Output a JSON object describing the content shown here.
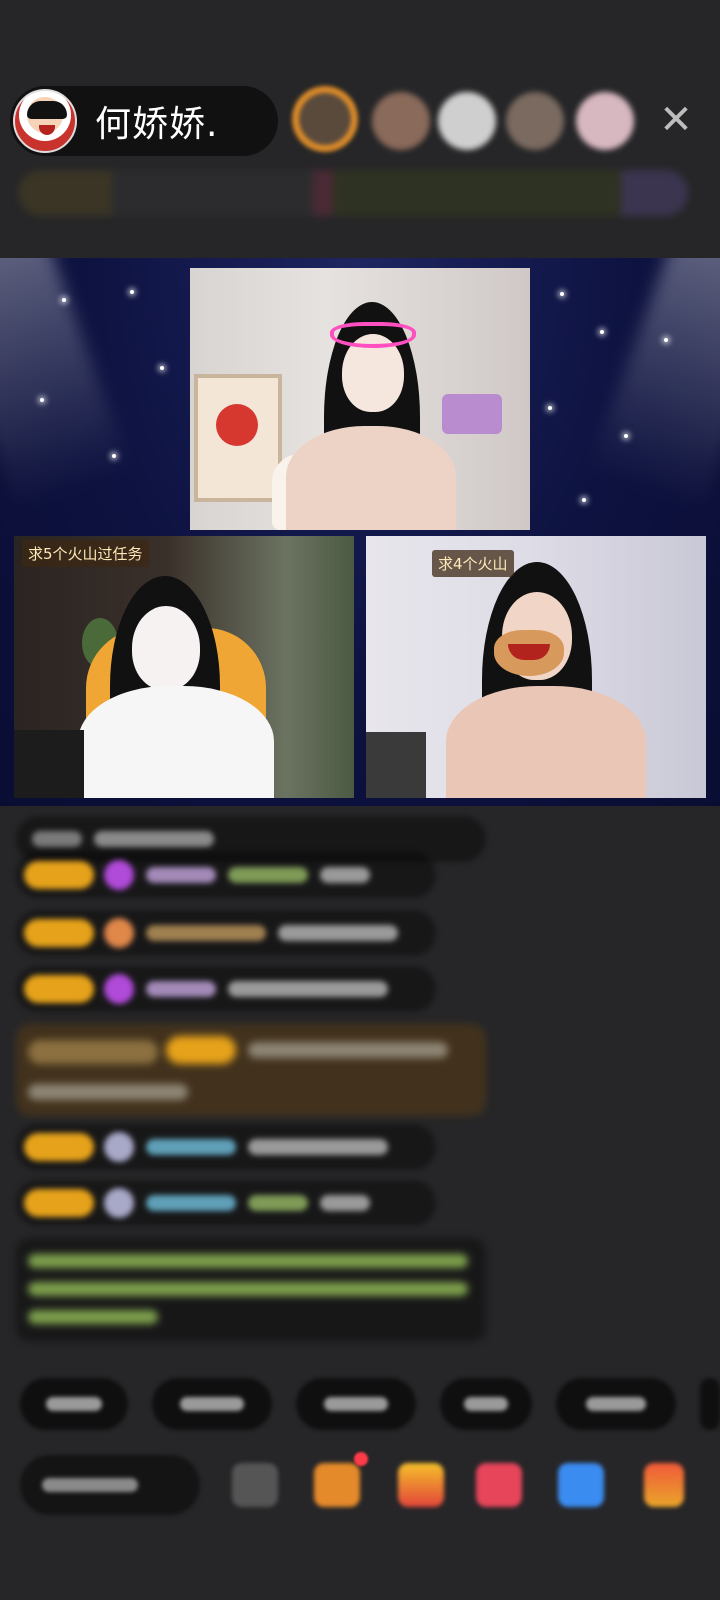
{
  "header": {
    "host_name": "何娇娇.",
    "close_icon": "close-icon"
  },
  "videos": {
    "left_task": "求5个火山过任务",
    "right_task": "求4个火山"
  },
  "colors": {
    "background": "#262628",
    "stage": "#0d1240",
    "task_tag_text": "#ffe9b8"
  }
}
